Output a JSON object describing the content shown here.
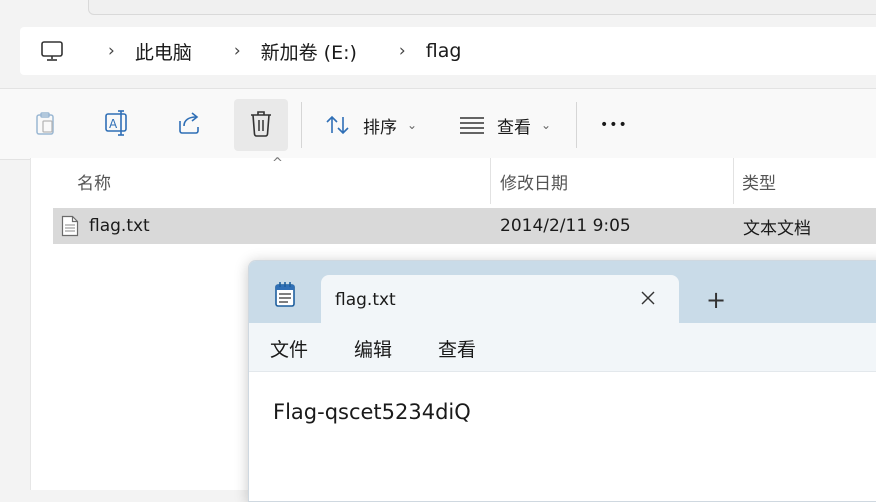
{
  "breadcrumb": {
    "items": [
      "此电脑",
      "新加卷 (E:)",
      "flag"
    ],
    "separator": "›"
  },
  "toolbar": {
    "sort_label": "排序",
    "view_label": "查看",
    "more_label": "•••"
  },
  "file_list": {
    "columns": [
      "名称",
      "修改日期",
      "类型"
    ],
    "rows": [
      {
        "name": "flag.txt",
        "modified": "2014/2/11 9:05",
        "type": "文本文档"
      }
    ]
  },
  "notepad": {
    "tab_title": "flag.txt",
    "menus": [
      "文件",
      "编辑",
      "查看"
    ],
    "content": "Flag-qscet5234diQ"
  },
  "colors": {
    "accent": "#2f6fb6",
    "selected_row": "#d9d9d9",
    "notepad_titlebar": "#c9dbe8"
  }
}
